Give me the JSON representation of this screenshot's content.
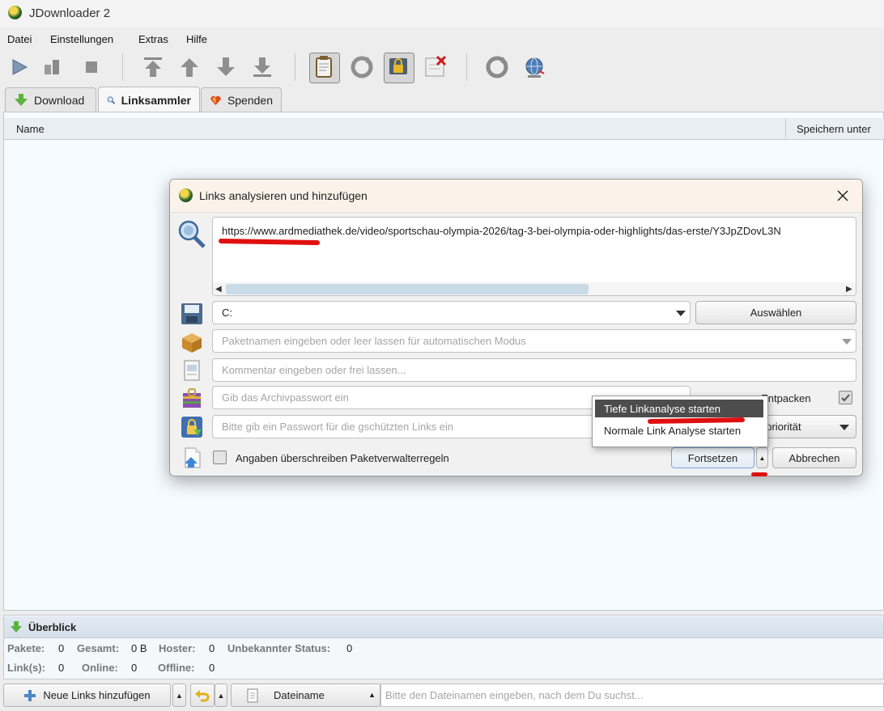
{
  "window": {
    "title": "JDownloader 2"
  },
  "menu": [
    "Datei",
    "Einstellungen",
    "Extras",
    "Hilfe"
  ],
  "tabs": [
    {
      "label": "Download",
      "icon": "download-arrow-icon"
    },
    {
      "label": "Linksammler",
      "icon": "linkgrabber-icon"
    },
    {
      "label": "Spenden",
      "icon": "heart-icon"
    }
  ],
  "table": {
    "columns": [
      "Name",
      "Speichern unter"
    ]
  },
  "dialog": {
    "title": "Links analysieren und hinzufügen",
    "url": "https://www.ardmediathek.de/video/sportschau-olympia-2026/tag-3-bei-olympia-oder-highlights/das-erste/Y3JpZDovL3N",
    "save_path": "C:",
    "choose_label": "Auswählen",
    "package_placeholder": "Paketnamen eingeben oder leer lassen für automatischen Modus",
    "comment_placeholder": "Kommentar eingeben oder frei lassen...",
    "archive_password_placeholder": "Gib das Archivpasswort ein",
    "extract_label_partial": "s Entpacken",
    "extract_checked": true,
    "link_password_placeholder": "Bitte gib ein Passwort für die gschützten Links ein",
    "priority_partial": "dpriorität",
    "overwrite_label": "Angaben überschreiben Paketverwalterregeln",
    "overwrite_checked": false,
    "continue_label": "Fortsetzen",
    "cancel_label": "Abbrechen",
    "menu_options": [
      "Tiefe Linkanalyse starten",
      "Normale Link Analyse starten"
    ]
  },
  "overview": {
    "title": "Überblick",
    "row1": [
      {
        "label": "Pakete:",
        "value": "0"
      },
      {
        "label": "Gesamt:",
        "value": "0 B"
      },
      {
        "label": "Hoster:",
        "value": "0"
      },
      {
        "label": "Unbekannter Status:",
        "value": "0"
      }
    ],
    "row2": [
      {
        "label": "Link(s):",
        "value": "0"
      },
      {
        "label": "Online:",
        "value": "0"
      },
      {
        "label": "Offline:",
        "value": "0"
      }
    ]
  },
  "bottom": {
    "add_links_label": "Neue Links hinzufügen",
    "sort_label": "Dateiname",
    "search_placeholder": "Bitte den Dateinamen eingeben, nach dem Du suchst..."
  },
  "colors": {
    "accent_red": "#e01010",
    "panel_bg": "#f6fbff",
    "dialog_title_bg": "#fbf3ea"
  }
}
